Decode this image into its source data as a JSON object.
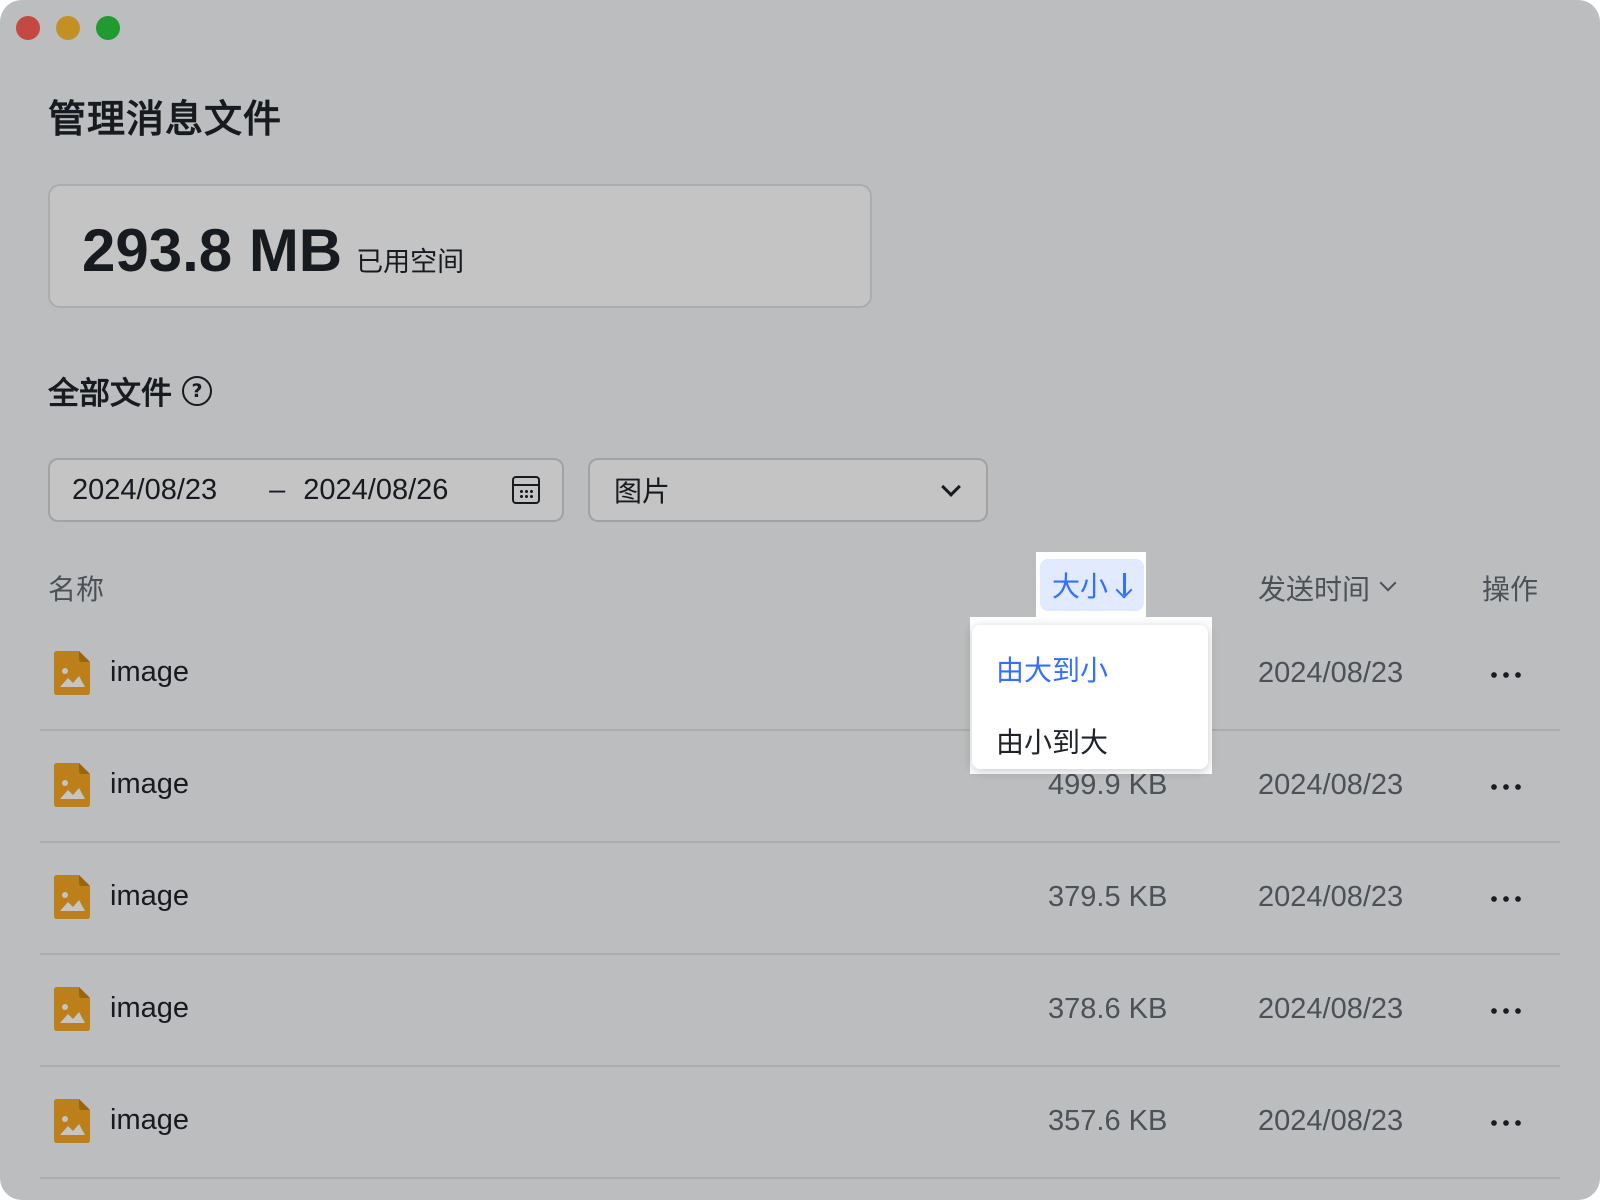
{
  "window": {
    "buttons": [
      "close",
      "minimize",
      "maximize"
    ]
  },
  "page": {
    "title": "管理消息文件"
  },
  "storage": {
    "used_value": "293.8 MB",
    "used_label": "已用空间"
  },
  "section": {
    "title": "全部文件",
    "help_icon": "question-circle-icon"
  },
  "filters": {
    "date_start": "2024/08/23",
    "date_separator": "–",
    "date_end": "2024/08/26",
    "calendar_icon": "calendar-icon",
    "file_type": "图片"
  },
  "table": {
    "headers": {
      "name": "名称",
      "size": "大小",
      "time": "发送时间",
      "actions": "操作"
    },
    "rows": [
      {
        "name": "image",
        "size": "",
        "date": "2024/08/23"
      },
      {
        "name": "image",
        "size": "499.9 KB",
        "date": "2024/08/23"
      },
      {
        "name": "image",
        "size": "379.5 KB",
        "date": "2024/08/23"
      },
      {
        "name": "image",
        "size": "378.6 KB",
        "date": "2024/08/23"
      },
      {
        "name": "image",
        "size": "357.6 KB",
        "date": "2024/08/23"
      }
    ]
  },
  "sort_menu": {
    "options": [
      {
        "label": "由大到小",
        "selected": true
      },
      {
        "label": "由小到大",
        "selected": false
      }
    ]
  },
  "colors": {
    "accent": "#3370ff",
    "file_icon": "#f5a623",
    "overlay": "rgba(0,0,0,0.23)"
  }
}
